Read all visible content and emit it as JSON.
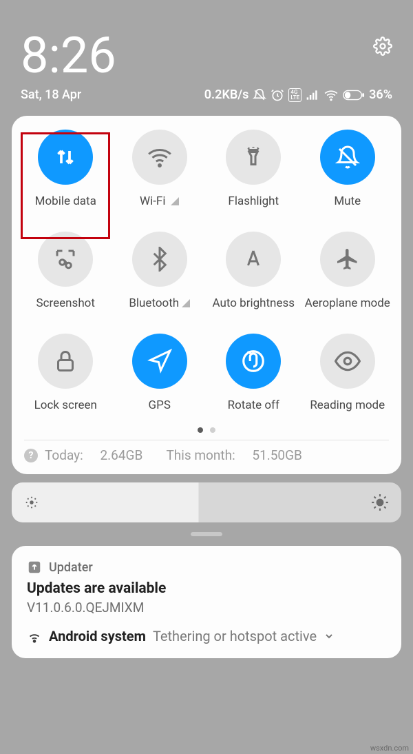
{
  "header": {
    "time": "8:26",
    "date": "Sat, 18 Apr",
    "data_rate": "0.2KB/s",
    "battery_pct": "36%"
  },
  "tiles": [
    {
      "icon": "mobile-data-icon",
      "label": "Mobile data",
      "active": true,
      "has_dropdown": false
    },
    {
      "icon": "wifi-icon",
      "label": "Wi-Fi",
      "active": false,
      "has_dropdown": true
    },
    {
      "icon": "flashlight-icon",
      "label": "Flashlight",
      "active": false,
      "has_dropdown": false
    },
    {
      "icon": "mute-icon",
      "label": "Mute",
      "active": true,
      "has_dropdown": false
    },
    {
      "icon": "screenshot-icon",
      "label": "Screenshot",
      "active": false,
      "has_dropdown": false
    },
    {
      "icon": "bluetooth-icon",
      "label": "Bluetooth",
      "active": false,
      "has_dropdown": true
    },
    {
      "icon": "auto-brightness-icon",
      "label": "Auto brightness",
      "active": false,
      "has_dropdown": false
    },
    {
      "icon": "aeroplane-icon",
      "label": "Aeroplane mode",
      "active": false,
      "has_dropdown": false
    },
    {
      "icon": "lock-icon",
      "label": "Lock screen",
      "active": false,
      "has_dropdown": false
    },
    {
      "icon": "gps-icon",
      "label": "GPS",
      "active": true,
      "has_dropdown": false
    },
    {
      "icon": "rotate-icon",
      "label": "Rotate off",
      "active": true,
      "has_dropdown": false
    },
    {
      "icon": "reading-icon",
      "label": "Reading mode",
      "active": false,
      "has_dropdown": false
    }
  ],
  "usage": {
    "today_label": "Today:",
    "today_value": "2.64GB",
    "month_label": "This month:",
    "month_value": "51.50GB"
  },
  "notification": {
    "app": "Updater",
    "title": "Updates are available",
    "subtitle": "V11.0.6.0.QEJMIXM",
    "sys_app": "Android system",
    "sys_text": "Tethering or hotspot active"
  },
  "watermark": "wsxdn.com"
}
